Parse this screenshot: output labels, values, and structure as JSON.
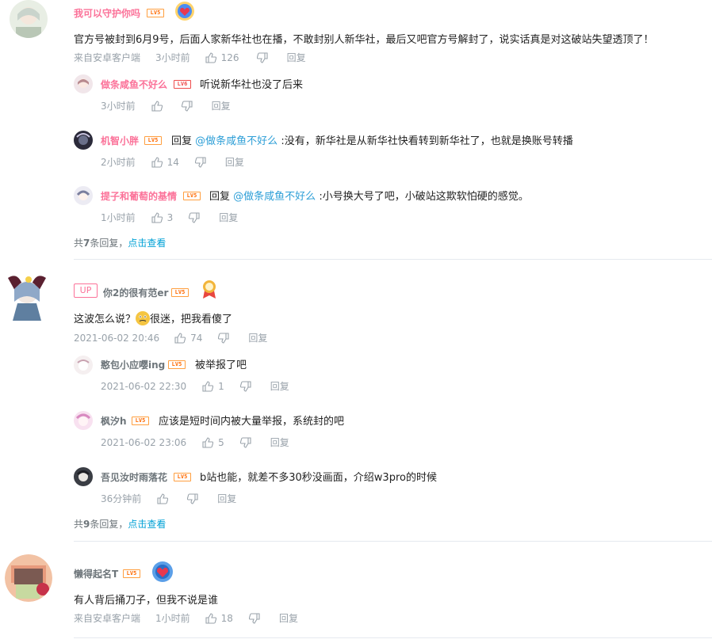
{
  "threads": [
    {
      "name": "我可以守护你吗",
      "level": "LV5",
      "text": "官方号被封到6月9号，后面人家新华社也在播，不敢封别人新华社，最后又吧官方号解封了，说实话真是对这破站失望透顶了！",
      "time": "来自安卓客户端",
      "ago": "3小时前",
      "likes": "126",
      "reply_label": "回复",
      "replies": [
        {
          "name": "做条咸鱼不好么",
          "level": "LV6",
          "text": "听说新华社也没了后来",
          "time": "3小时前",
          "likes": "",
          "reply_label": "回复"
        },
        {
          "name": "机智小胖",
          "level": "LV5",
          "reply_prefix": "回复",
          "at": "@做条咸鱼不好么",
          "text": ":没有，新华社是从新华社快看转到新华社了，也就是换账号转播",
          "time": "2小时前",
          "likes": "14",
          "reply_label": "回复"
        },
        {
          "name": "提子和葡萄的基情",
          "level": "LV5",
          "reply_prefix": "回复",
          "at": "@做条咸鱼不好么",
          "text": ":小号换大号了吧，小破站这欺软怕硬的感觉。",
          "time": "1小时前",
          "likes": "3",
          "reply_label": "回复"
        }
      ],
      "more_prefix": "共",
      "more_count": "7",
      "more_suffix": "条回复，",
      "more_link": "点击查看"
    },
    {
      "up_tag": "UP",
      "name": "你2的很有范er",
      "level": "LV5",
      "text_before": "这波怎么说？",
      "text_after": "很迷，把我看傻了",
      "time": "2021-06-02 20:46",
      "likes": "74",
      "reply_label": "回复",
      "replies": [
        {
          "name": "憨包小应嘤ing",
          "level": "LV5",
          "text": "被举报了吧",
          "time": "2021-06-02 22:30",
          "likes": "1",
          "reply_label": "回复"
        },
        {
          "name": "枫汐h",
          "level": "LV5",
          "text": "应该是短时间内被大量举报，系统封的吧",
          "time": "2021-06-02 23:06",
          "likes": "5",
          "reply_label": "回复"
        },
        {
          "name": "吾见汝时雨落花",
          "level": "LV5",
          "text": "b站也能，就差不多30秒没画面，介绍w3pro的时候",
          "time": "36分钟前",
          "likes": "",
          "reply_label": "回复"
        }
      ],
      "more_prefix": "共",
      "more_count": "9",
      "more_suffix": "条回复，",
      "more_link": "点击查看"
    },
    {
      "name": "懒得起名T",
      "level": "LV5",
      "text": "有人背后捅刀子，但我不说是谁",
      "time": "来自安卓客户端",
      "ago": "1小时前",
      "likes": "18",
      "reply_label": "回复"
    }
  ],
  "colors": {
    "pink": "#fb7299",
    "link": "#00a1d6",
    "meta": "#99a2aa",
    "level": "#ff6a00"
  }
}
